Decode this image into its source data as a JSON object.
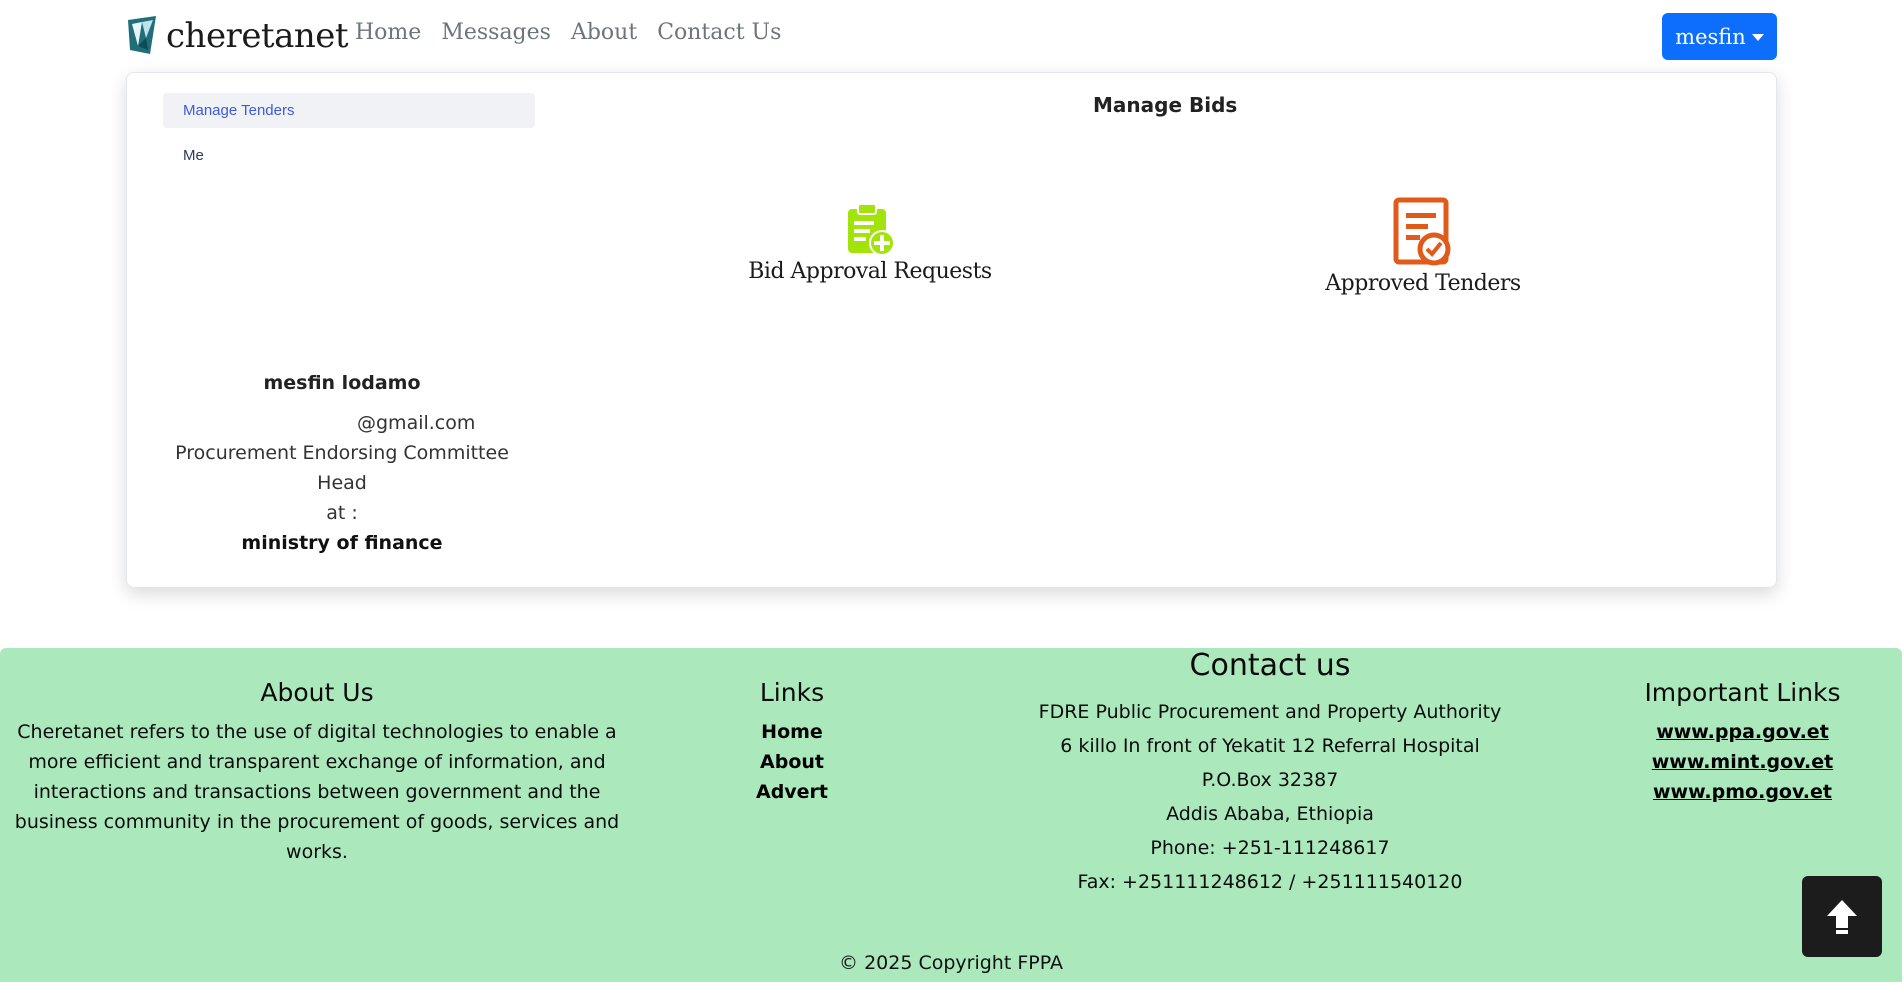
{
  "navbar": {
    "brand": "cheretanet",
    "links": [
      "Home",
      "Messages",
      "About",
      "Contact Us"
    ],
    "user_label": "mesfin"
  },
  "sidebar": {
    "items": [
      "Manage Tenders",
      "Me"
    ]
  },
  "profile": {
    "name": "mesfin lodamo",
    "email": "@gmail.com",
    "role": "Procurement Endorsing Committee Head",
    "at_label": "at :",
    "organization": "ministry of finance"
  },
  "main": {
    "title": "Manage Bids",
    "tiles": [
      {
        "label": "Bid Approval Requests",
        "icon": "clipboard-add-icon",
        "color": "#a3e30c"
      },
      {
        "label": "Approved Tenders",
        "icon": "document-check-icon",
        "color": "#e05a1a"
      }
    ]
  },
  "footer": {
    "about": {
      "heading": "About Us",
      "text": "Cheretanet refers to the use of digital technologies to enable a more efficient and transparent exchange of information, and interactions and transactions between government and the business community in the procurement of goods, services and works."
    },
    "links": {
      "heading": "Links",
      "items": [
        "Home",
        "About",
        "Advert"
      ]
    },
    "contact": {
      "heading": "Contact us",
      "lines": [
        "FDRE Public Procurement and Property Authority",
        "6 killo In front of Yekatit 12 Referral Hospital",
        "P.O.Box 32387",
        "Addis Ababa, Ethiopia",
        "Phone: +251-111248617",
        "Fax: +251111248612 / +251111540120"
      ]
    },
    "important_links": {
      "heading": "Important Links",
      "items": [
        "www.ppa.gov.et",
        "www.mint.gov.et",
        "www.pmo.gov.et"
      ]
    },
    "copyright": "© 2025 Copyright FPPA"
  },
  "colors": {
    "primary": "#0d6efd",
    "footer_bg": "#abe9bd",
    "sidebar_active_text": "#3b5bdb"
  }
}
